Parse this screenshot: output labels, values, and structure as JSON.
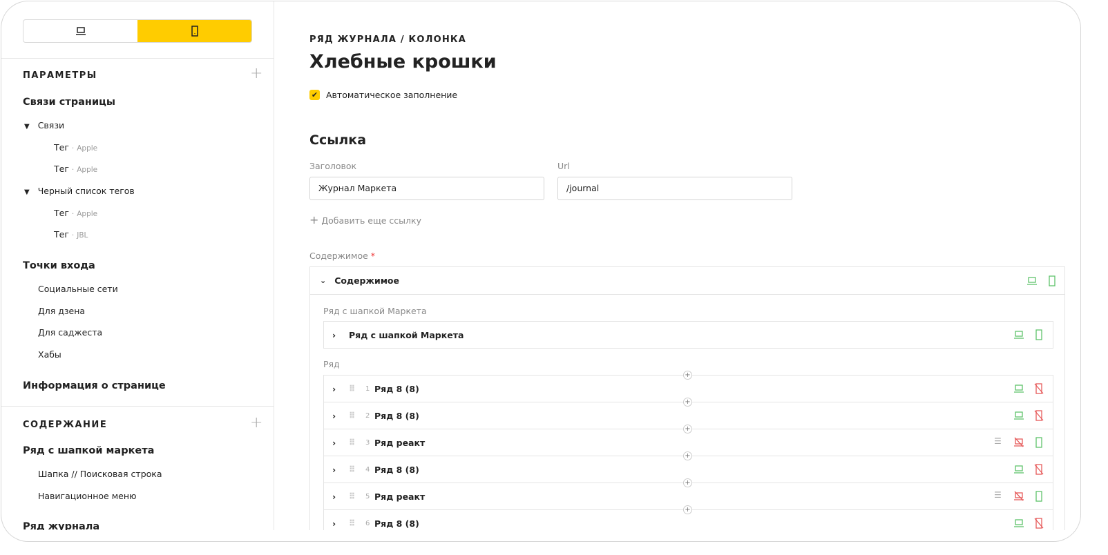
{
  "sidebar": {
    "params_title": "ПАРАМЕТРЫ",
    "links_title": "Связи страницы",
    "groups": [
      {
        "label": "Связи",
        "items": [
          {
            "name": "Тег",
            "tag": "Apple"
          },
          {
            "name": "Тег",
            "tag": "Apple"
          }
        ]
      },
      {
        "label": "Черный список тегов",
        "items": [
          {
            "name": "Тег",
            "tag": "Apple"
          },
          {
            "name": "Тег",
            "tag": "JBL"
          }
        ]
      }
    ],
    "entry_title": "Точки входа",
    "entries": [
      "Социальные сети",
      "Для дзена",
      "Для саджеста",
      "Хабы"
    ],
    "info_title": "Информация о странице",
    "content_title": "СОДЕРЖАНИЕ",
    "content_group": "Ряд с шапкой маркета",
    "content_items": [
      "Шапка // Поисковая строка",
      "Навигационное меню"
    ],
    "journal_title": "Ряд журнала",
    "separator": "·"
  },
  "main": {
    "breadcrumb": "РЯД ЖУРНАЛА / КОЛОНКА",
    "title": "Хлебные крошки",
    "autofill_label": "Автоматическое заполнение",
    "link_section": "Ссылка",
    "title_label": "Заголовок",
    "title_value": "Журнал Маркета",
    "url_label": "Url",
    "url_value": "/journal",
    "add_link": "Добавить еще ссылку",
    "content_label": "Содержимое",
    "required_mark": "*",
    "content_header": "Содержимое",
    "header_row_label": "Ряд с шапкой Маркета",
    "header_row_title": "Ряд с шапкой Маркета",
    "rows_label": "Ряд",
    "rows": [
      {
        "num": "1",
        "title": "Ряд 8 (8)",
        "desktop": true,
        "mobile": false,
        "list": false
      },
      {
        "num": "2",
        "title": "Ряд 8 (8)",
        "desktop": true,
        "mobile": false,
        "list": false
      },
      {
        "num": "3",
        "title": "Ряд реакт",
        "desktop": false,
        "mobile": true,
        "list": true
      },
      {
        "num": "4",
        "title": "Ряд 8 (8)",
        "desktop": true,
        "mobile": false,
        "list": false
      },
      {
        "num": "5",
        "title": "Ряд реакт",
        "desktop": false,
        "mobile": true,
        "list": true
      },
      {
        "num": "6",
        "title": "Ряд 8 (8)",
        "desktop": true,
        "mobile": false,
        "list": false
      }
    ]
  },
  "colors": {
    "accent": "#ffcc00",
    "green": "#5fc46b",
    "red": "#e65a5a"
  }
}
